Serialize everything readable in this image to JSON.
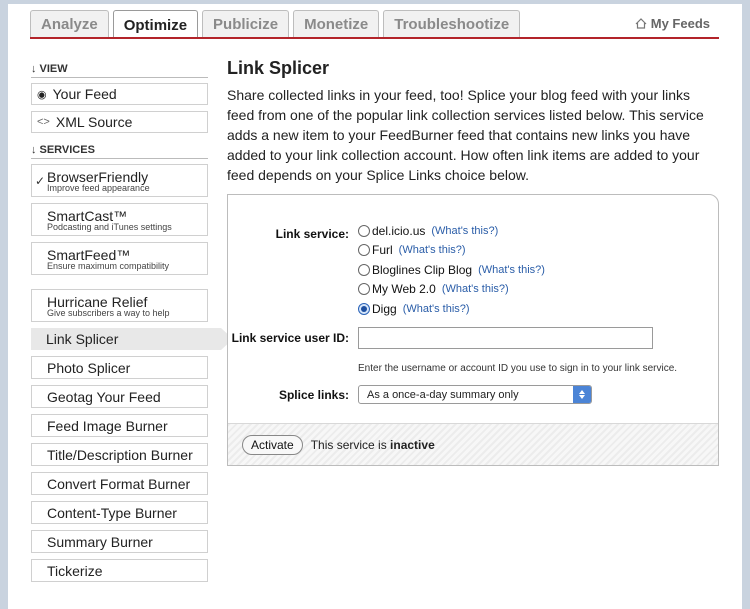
{
  "tabs": [
    {
      "label": "Analyze",
      "active": false
    },
    {
      "label": "Optimize",
      "active": true
    },
    {
      "label": "Publicize",
      "active": false
    },
    {
      "label": "Monetize",
      "active": false
    },
    {
      "label": "Troubleshootize",
      "active": false
    }
  ],
  "my_feeds": "My Feeds",
  "sidebar": {
    "view_header": "VIEW",
    "view_items": [
      {
        "label": "Your Feed",
        "icon": "eye-icon"
      },
      {
        "label": "XML Source",
        "icon": "code-icon"
      }
    ],
    "services_header": "SERVICES",
    "services": [
      {
        "label": "BrowserFriendly",
        "sub": "Improve feed appearance",
        "checked": true
      },
      {
        "label": "SmartCast™",
        "sub": "Podcasting and iTunes settings"
      },
      {
        "label": "SmartFeed™",
        "sub": "Ensure maximum compatibility"
      },
      {
        "label": "Hurricane Relief",
        "sub": "Give subscribers a way to help"
      }
    ],
    "items": [
      {
        "label": "Link Splicer",
        "selected": true
      },
      {
        "label": "Photo Splicer"
      },
      {
        "label": "Geotag Your Feed"
      },
      {
        "label": "Feed Image Burner"
      },
      {
        "label": "Title/Description Burner"
      },
      {
        "label": "Convert Format Burner"
      },
      {
        "label": "Content-Type Burner"
      },
      {
        "label": "Summary Burner"
      },
      {
        "label": "Tickerize"
      }
    ]
  },
  "main": {
    "title": "Link Splicer",
    "description": "Share collected links in your feed, too! Splice your blog feed with your links feed from one of the popular link collection services listed below. This service adds a new item to your FeedBurner feed that contains new links you have added to your link collection account. How often link items are added to your feed depends on your Splice Links choice below.",
    "form": {
      "link_service_label": "Link service:",
      "services": [
        {
          "label": "del.icio.us",
          "help": "(What's this?)",
          "selected": false
        },
        {
          "label": "Furl",
          "help": "(What's this?)",
          "selected": false
        },
        {
          "label": "Bloglines Clip Blog",
          "help": "(What's this?)",
          "selected": false
        },
        {
          "label": "My Web 2.0",
          "help": "(What's this?)",
          "selected": false
        },
        {
          "label": "Digg",
          "help": "(What's this?)",
          "selected": true
        }
      ],
      "user_id_label": "Link service user ID:",
      "user_id_value": "",
      "hint": "Enter the username or account ID you use to sign in to your link service.",
      "splice_label": "Splice links:",
      "splice_value": "As a once-a-day summary only",
      "activate_label": "Activate",
      "status_prefix": "This service is",
      "status_value": "inactive"
    }
  }
}
